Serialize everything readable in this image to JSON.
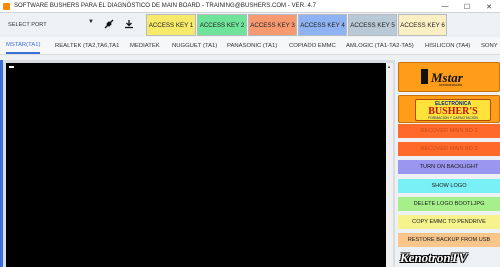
{
  "window": {
    "title": "SOFTWARE BUSHERS PARA EL DIAGNÓSTICO DE MAIN BOARD - TRAINING@BUSHERS.COM - VER. 4.7",
    "controls": [
      "—",
      "☐",
      "✕"
    ]
  },
  "toolbar": {
    "port_placeholder": "SELECT PORT",
    "access_keys": [
      {
        "label": "ACCESS KEY 1",
        "color": "#f7e96a"
      },
      {
        "label": "ACCESS KEY 2",
        "color": "#6fe39a"
      },
      {
        "label": "ACCESS KEY 3",
        "color": "#f79a72"
      },
      {
        "label": "ACCESS KEY 4",
        "color": "#8fb2f2"
      },
      {
        "label": "ACCESS KEY 5",
        "color": "#b9c9d6"
      },
      {
        "label": "ACCESS KEY 6",
        "color": "#fbf0c4"
      }
    ]
  },
  "tabs": [
    "MSTAR(TA1)",
    "REALTEK (TA2,TA6,TA1",
    "MEDIATEK",
    "NUGGUET (TA1)",
    "PANASONIC (TA1)",
    "COPIADO EMMC",
    "AMLOGIC (TA1-TA2-TA5)",
    "HISILICON (TA4)",
    "SONY"
  ],
  "logos": {
    "mstar": {
      "word": "Mstar",
      "sub": "semiconductor"
    },
    "bushers": {
      "top": "ELECTRÓNICA",
      "main": "BUSHER'S",
      "sub": "FORMACIÓN Y CAPACITACIÓN"
    }
  },
  "actions": [
    {
      "label": "RECOVER MAIN BD 1",
      "bg": "#ff6a2a",
      "fg": "#c84a1a"
    },
    {
      "label": "RECOVER MAIN BD 2",
      "bg": "#ff6a2a",
      "fg": "#c84a1a"
    },
    {
      "label": "TURN ON BACKLIGHT",
      "bg": "#9b96f0",
      "fg": "#1a1a1a"
    },
    {
      "label": "SHOW LOGO",
      "bg": "#79f0f5",
      "fg": "#1a1a1a"
    },
    {
      "label": "DELETE LOGO BOOTLJPG",
      "bg": "#a6f08c",
      "fg": "#1a1a1a"
    },
    {
      "label": "COPY EMMC TO PENDRIVE",
      "bg": "#f6f28c",
      "fg": "#1a1a1a"
    },
    {
      "label": "RESTORE BACKUP FROM USB",
      "bg": "#f8c58a",
      "fg": "#1a1a1a"
    }
  ],
  "watermark": "KenotronTV"
}
